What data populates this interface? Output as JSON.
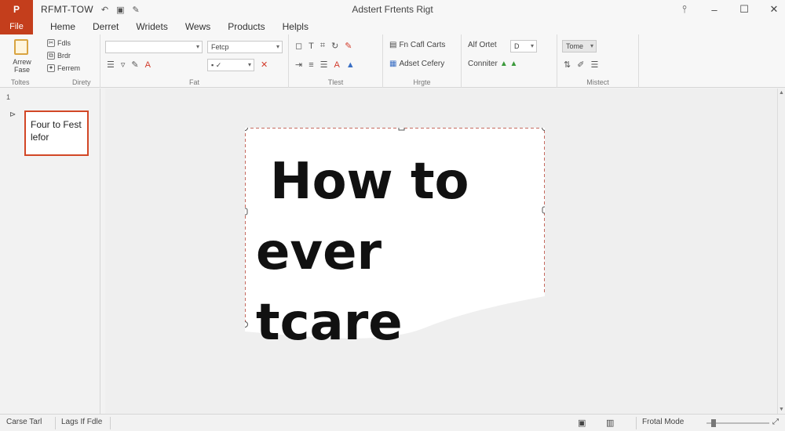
{
  "titlebar": {
    "app_logo": "P",
    "doc_name": "RFMT-TOW",
    "window_title": "Adstert Frtents Rigt"
  },
  "tabs": {
    "file": "File",
    "items": [
      "Heme",
      "Derret",
      "Wridets",
      "Wews",
      "Products",
      "Helpls"
    ]
  },
  "ribbon": {
    "clipboard": {
      "paste_label": "Arrew Fase",
      "items": [
        "Fdls",
        "Brdr",
        "Ferrem"
      ],
      "label": "Toltes",
      "label2": "Direty"
    },
    "font": {
      "font_name": "",
      "font_size": "Fetcp",
      "label": "Fat"
    },
    "tlest": {
      "label": "Tlest"
    },
    "arrange": {
      "items": [
        "Fn Cafl Carts",
        "Adset Cefery"
      ],
      "label": "Hrgte"
    },
    "alignment": {
      "item1": "Alf Ortet",
      "item1_value": "D",
      "item2": "Conniter"
    },
    "mistect": {
      "combo": "Tome",
      "label": "Mistect"
    }
  },
  "thumbpane": {
    "slide_number": "1",
    "thumb_text": "Four to Fest lefor"
  },
  "slide": {
    "line1": "How to",
    "line2": "ever tcare"
  },
  "statusbar": {
    "item1": "Carse Tarl",
    "item2": "Lags If Fdle",
    "mode": "Frotal Mode"
  },
  "colors": {
    "accent": "#c43e1c",
    "selection_border": "#b33a2c"
  }
}
